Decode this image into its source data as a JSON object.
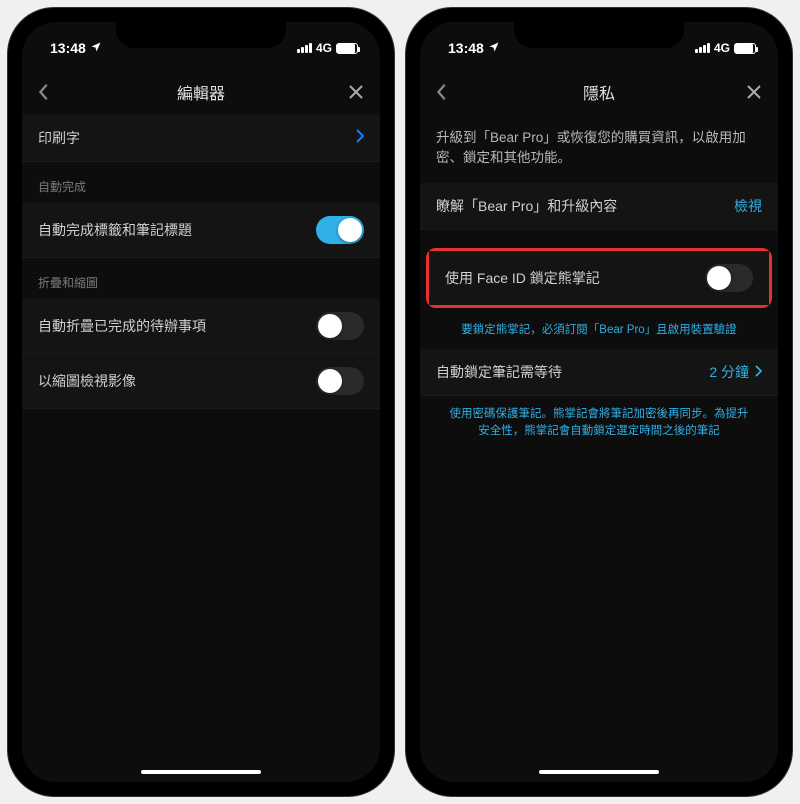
{
  "status": {
    "time": "13:48",
    "network": "4G"
  },
  "left": {
    "title": "編輯器",
    "rows": {
      "typography": "印刷字",
      "section_autocomplete": "自動完成",
      "autocomplete_titles": "自動完成標籤和筆記標題",
      "section_fold": "折疊和縮圖",
      "autofold_done": "自動折疊已完成的待辦事項",
      "thumbnail_view": "以縮圖檢視影像"
    }
  },
  "right": {
    "title": "隱私",
    "upgrade_info": "升級到「Bear Pro」或恢復您的購買資訊，以啟用加密、鎖定和其他功能。",
    "learn_label": "瞭解「Bear Pro」和升級內容",
    "learn_action": "檢視",
    "faceid_label": "使用 Face ID 鎖定熊掌記",
    "faceid_hint": "要鎖定熊掌記，必須訂閱「Bear Pro」且啟用裝置驗證",
    "autolock_label": "自動鎖定筆記需等待",
    "autolock_value": "2 分鐘",
    "footer_hint": "使用密碼保護筆記。熊掌記會將筆記加密後再同步。為提升安全性，熊掌記會自動鎖定選定時間之後的筆記"
  }
}
